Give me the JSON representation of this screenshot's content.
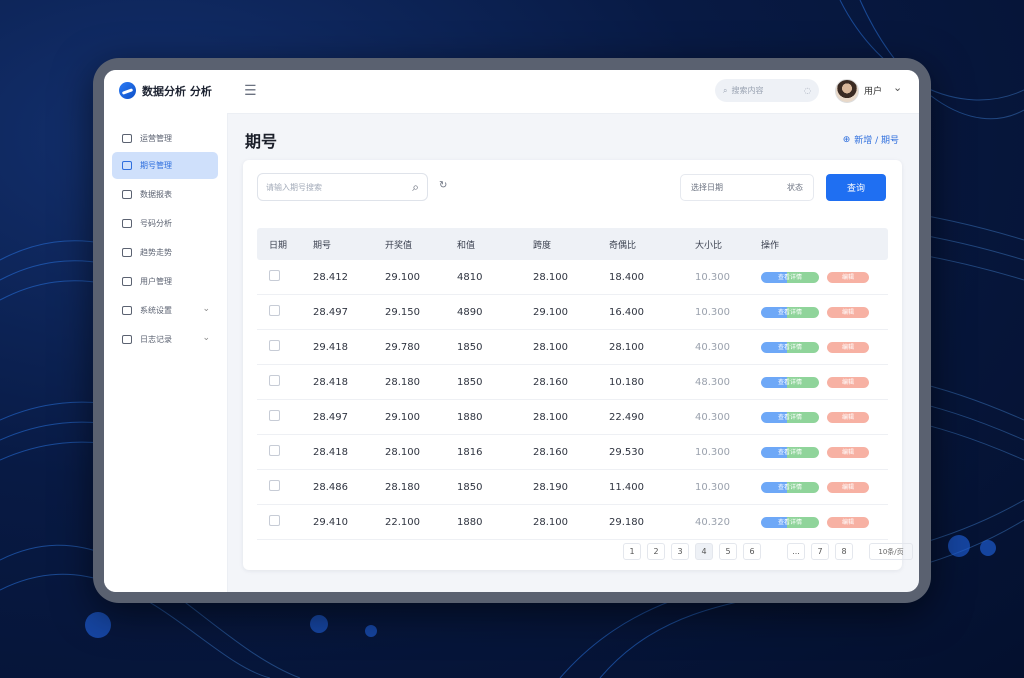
{
  "app": {
    "title": "数据分析 分析"
  },
  "header": {
    "search_placeholder": "搜索内容",
    "user_name": "用户"
  },
  "sidebar": {
    "items": [
      {
        "label": "运营管理",
        "icon": "dashboard-icon",
        "active": false
      },
      {
        "label": "期号管理",
        "icon": "calendar-icon",
        "active": true
      },
      {
        "label": "数据报表",
        "icon": "report-icon",
        "active": false
      },
      {
        "label": "号码分析",
        "icon": "analysis-icon",
        "active": false
      },
      {
        "label": "趋势走势",
        "icon": "trend-icon",
        "active": false
      },
      {
        "label": "用户管理",
        "icon": "users-icon",
        "active": false
      },
      {
        "label": "系统设置",
        "icon": "settings-icon",
        "active": false,
        "expandable": true
      },
      {
        "label": "日志记录",
        "icon": "log-icon",
        "active": false,
        "expandable": true
      }
    ]
  },
  "page": {
    "title": "期号",
    "top_link": "新增 / 期号"
  },
  "toolbar": {
    "search_placeholder": "请输入期号搜索",
    "filter_left": "选择日期",
    "filter_right": "状态",
    "query_button": "查询"
  },
  "table": {
    "headers": [
      "日期",
      "期号",
      "开奖值",
      "和值",
      "跨度",
      "奇偶比",
      "大小比",
      "操作"
    ],
    "rows": [
      [
        "",
        "28.412",
        "29.100",
        "4810",
        "28.100",
        "18.400",
        "10.300",
        [
          "查看详情",
          "编辑"
        ]
      ],
      [
        "",
        "28.497",
        "29.150",
        "4890",
        "29.100",
        "16.400",
        "10.300",
        [
          "查看详情",
          "编辑"
        ]
      ],
      [
        "",
        "29.418",
        "29.780",
        "1850",
        "28.100",
        "28.100",
        "40.300",
        [
          "查看详情",
          "编辑"
        ]
      ],
      [
        "",
        "28.418",
        "28.180",
        "1850",
        "28.160",
        "10.180",
        "48.300",
        [
          "查看详情",
          "编辑"
        ]
      ],
      [
        "",
        "28.497",
        "29.100",
        "1880",
        "28.100",
        "22.490",
        "40.300",
        [
          "查看详情",
          "编辑"
        ]
      ],
      [
        "",
        "28.418",
        "28.100",
        "1816",
        "28.160",
        "29.530",
        "10.300",
        [
          "查看详情",
          "编辑"
        ]
      ],
      [
        "",
        "28.486",
        "28.180",
        "1850",
        "28.190",
        "11.400",
        "10.300",
        [
          "查看详情",
          "编辑"
        ]
      ],
      [
        "",
        "29.410",
        "22.100",
        "1880",
        "28.100",
        "29.180",
        "40.320",
        [
          "查看详情",
          "编辑"
        ]
      ]
    ]
  },
  "pagination": {
    "pages": [
      "1",
      "2",
      "3",
      "4",
      "5",
      "6"
    ],
    "current": "4",
    "extra": [
      "...",
      "7",
      "8"
    ],
    "page_size": "10条/页"
  },
  "colors": {
    "accent": "#1f6ff2",
    "active_nav_bg": "#cfe0fb",
    "tag_blue": "#6ea8f7",
    "tag_green": "#8fd49a",
    "tag_salmon": "#f7b1a3"
  }
}
